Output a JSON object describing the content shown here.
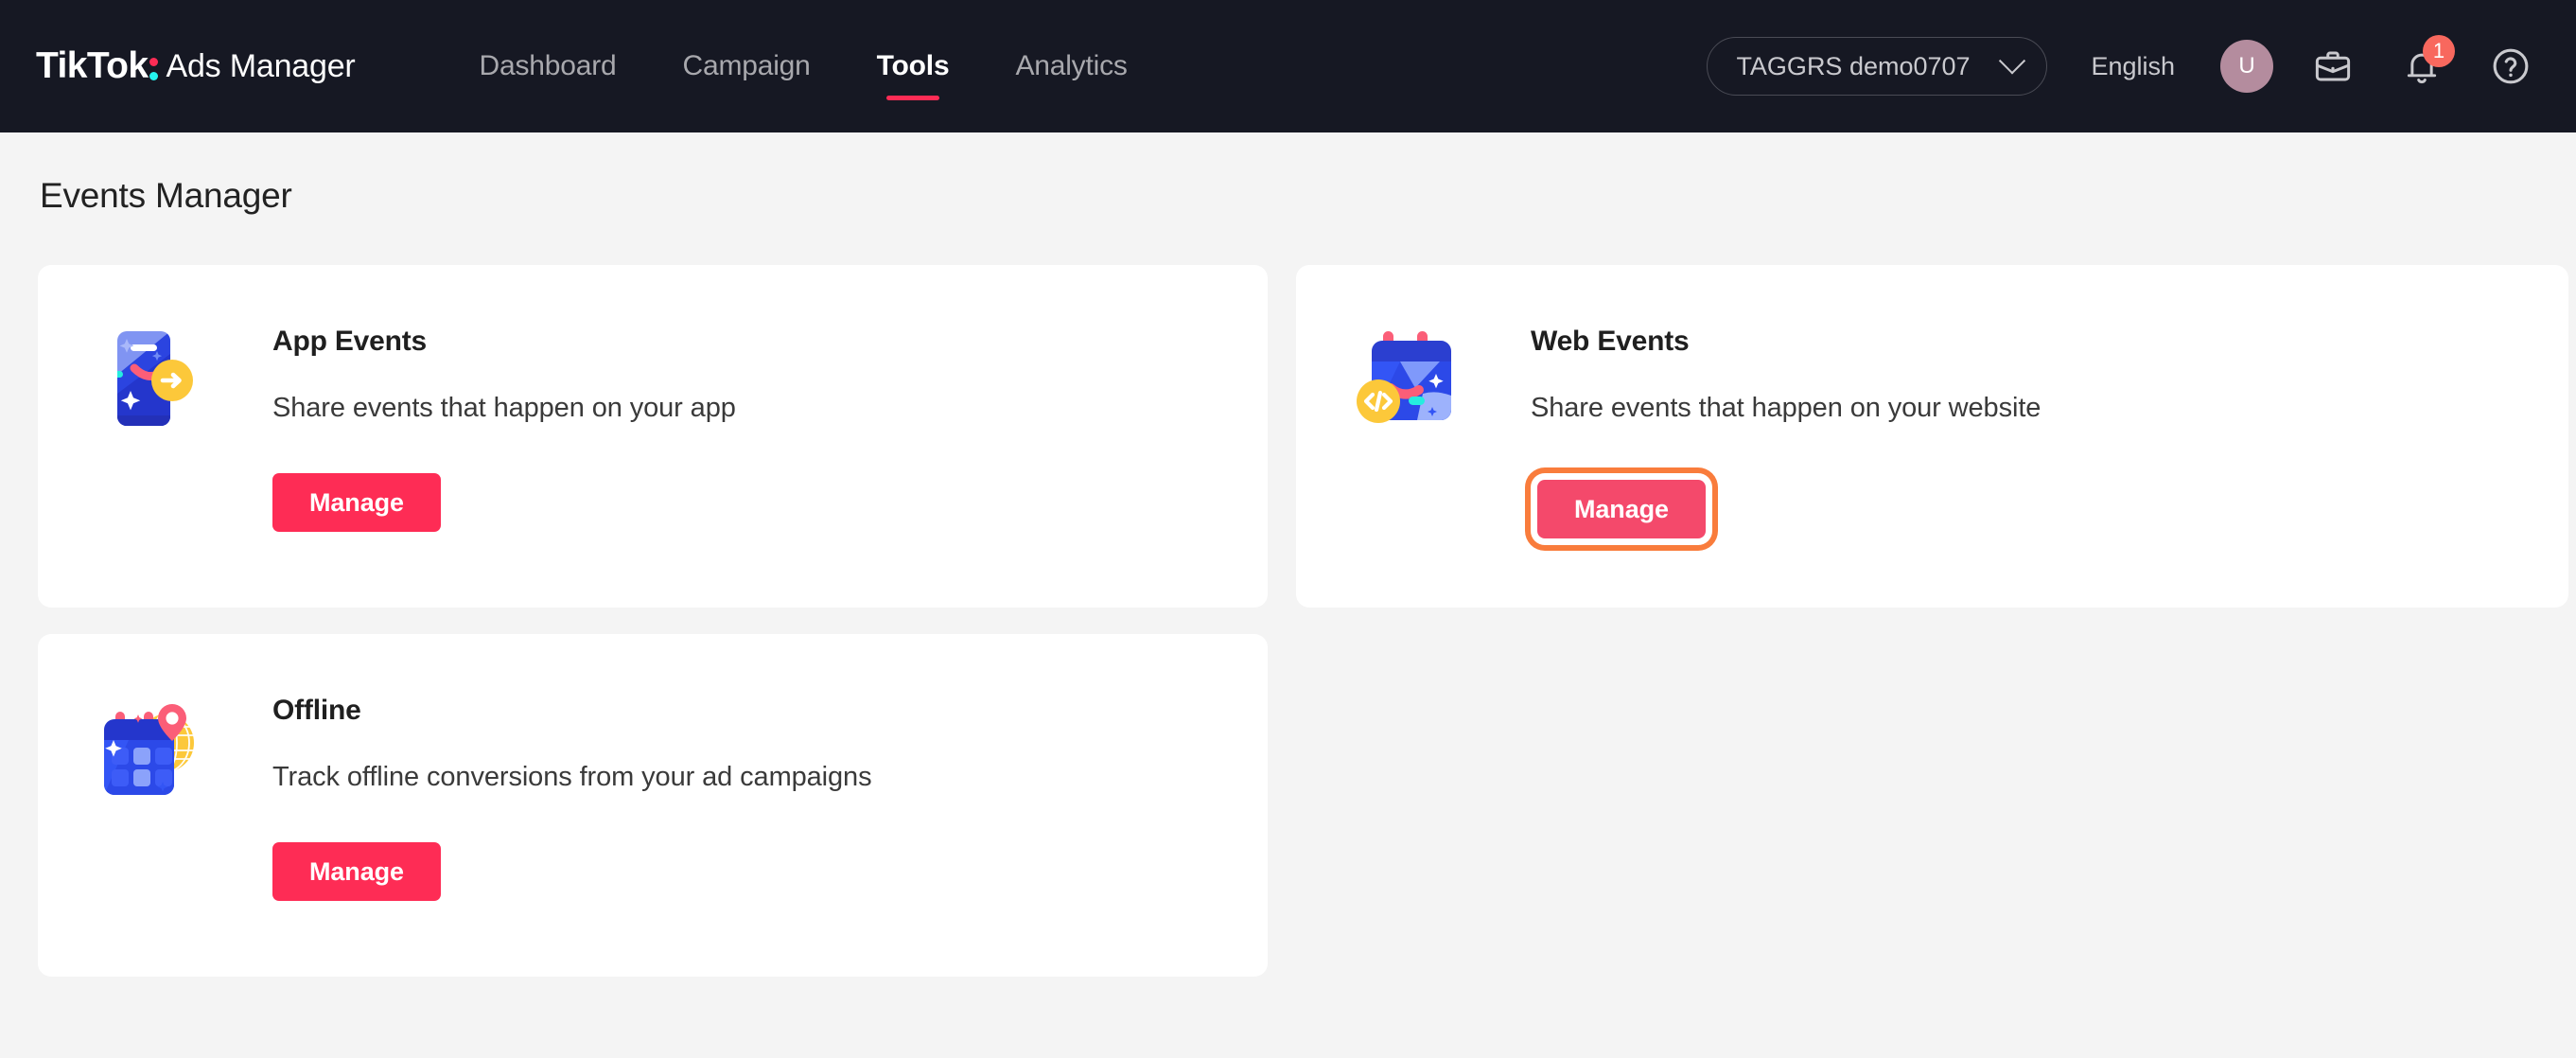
{
  "header": {
    "brand_name": "TikTok",
    "brand_product": "Ads Manager",
    "nav": [
      {
        "label": "Dashboard",
        "active": false
      },
      {
        "label": "Campaign",
        "active": false
      },
      {
        "label": "Tools",
        "active": true
      },
      {
        "label": "Analytics",
        "active": false
      }
    ],
    "account_selector": {
      "value": "TAGGRS demo0707",
      "icon": "chevron-down-icon"
    },
    "language": "English",
    "avatar_initial": "U",
    "icons": {
      "briefcase": "briefcase-icon",
      "notifications": "bell-icon",
      "help": "help-circle-icon"
    },
    "notification_count": "1"
  },
  "page": {
    "title": "Events Manager"
  },
  "cards": [
    {
      "id": "app-events",
      "title": "App Events",
      "description": "Share events that happen on your app",
      "button_label": "Manage",
      "icon": "app-events-illustration",
      "highlighted": false
    },
    {
      "id": "web-events",
      "title": "Web Events",
      "description": "Share events that happen on your website",
      "button_label": "Manage",
      "icon": "web-events-illustration",
      "highlighted": true
    },
    {
      "id": "offline",
      "title": "Offline",
      "description": "Track offline conversions from your ad campaigns",
      "button_label": "Manage",
      "icon": "offline-illustration",
      "highlighted": false
    }
  ],
  "colors": {
    "brand_pink": "#FE2C55",
    "brand_cyan": "#25F4EE",
    "topbar_bg": "#161823",
    "page_bg": "#F4F4F4",
    "card_bg": "#FFFFFF",
    "highlight_ring": "#F97C3C",
    "badge_red": "#F8685E",
    "avatar_bg": "#B48C9E"
  }
}
